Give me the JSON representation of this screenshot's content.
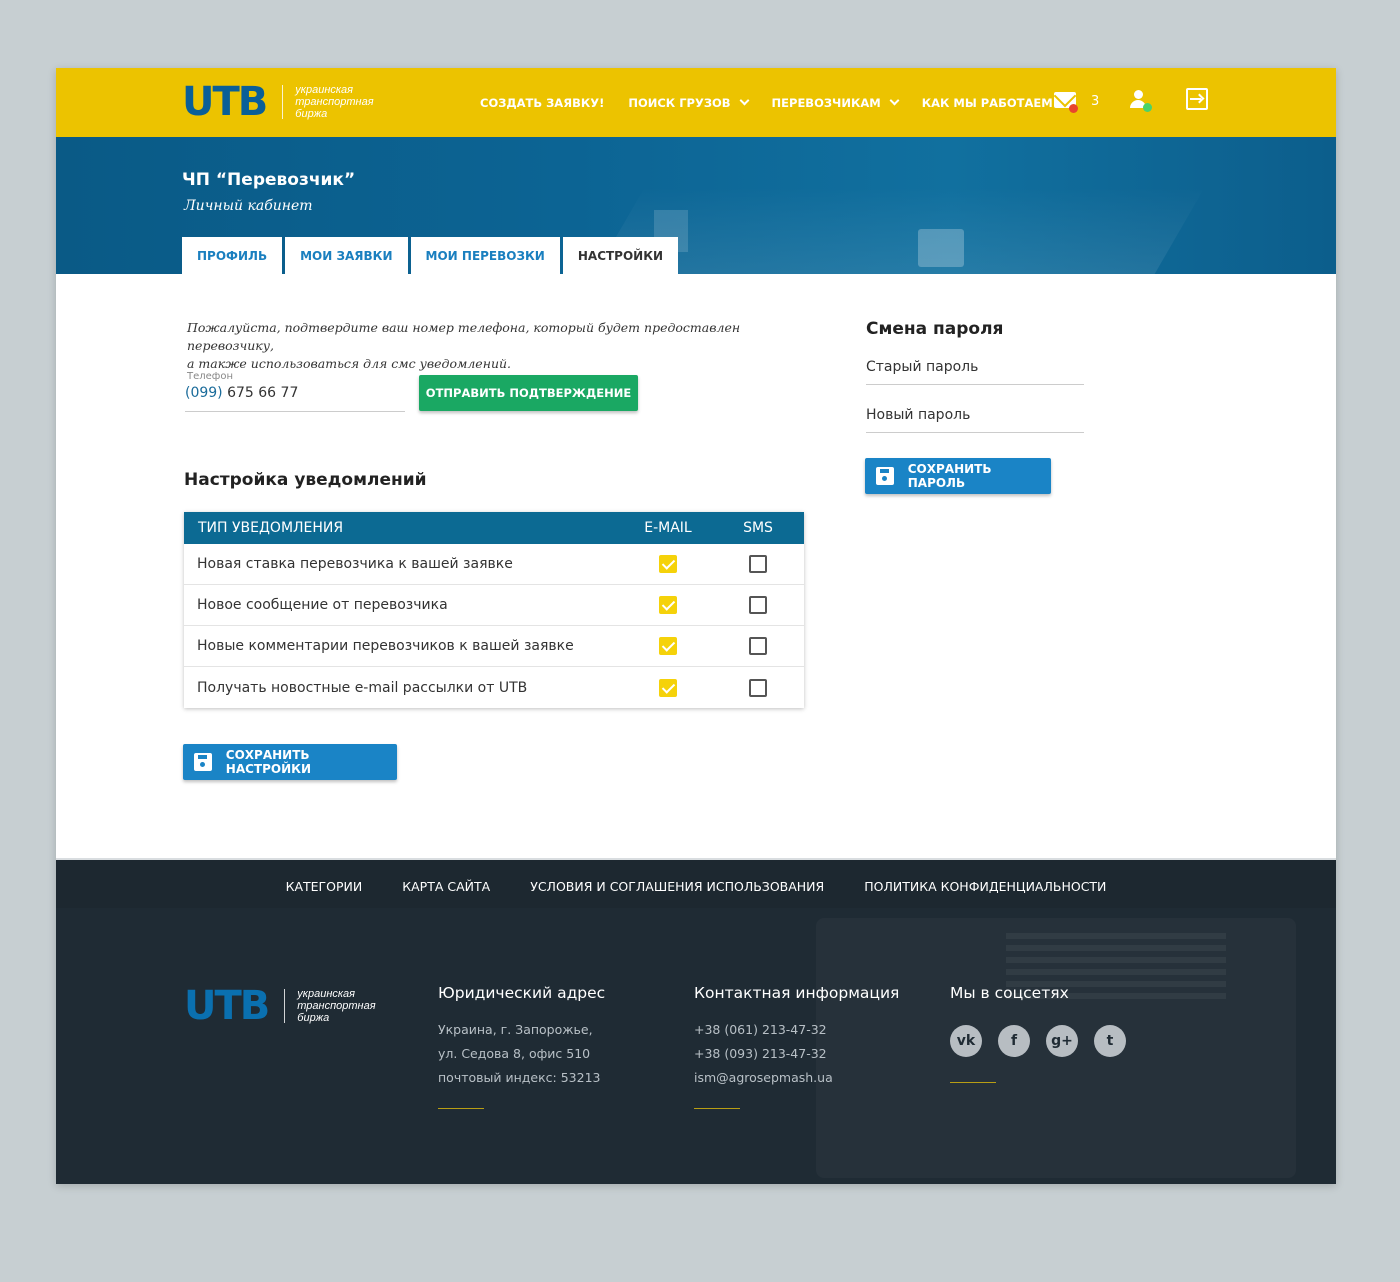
{
  "header": {
    "logo": "UTB",
    "logo_tag": [
      "украинская",
      "транспортная",
      "биржа"
    ],
    "nav": [
      {
        "label": "СОЗДАТЬ ЗАЯВКУ!",
        "dropdown": false
      },
      {
        "label": "ПОИСК ГРУЗОВ",
        "dropdown": true
      },
      {
        "label": "ПЕРЕВОЗЧИКАМ",
        "dropdown": true
      },
      {
        "label": "КАК МЫ РАБОТАЕМ",
        "dropdown": true
      }
    ],
    "mail_count": "3",
    "icons": {
      "mail": "mail-icon",
      "user": "user-icon",
      "logout": "logout-icon"
    },
    "colors": {
      "bar": "#ecc300",
      "mail_dot": "#e8452c",
      "user_dot": "#4ad36a"
    }
  },
  "hero": {
    "company": "ЧП “Перевозчик”",
    "subtitle": "Личный кабинет",
    "tabs": [
      {
        "label": "ПРОФИЛЬ",
        "active": false
      },
      {
        "label": "МОИ ЗАЯВКИ",
        "active": false
      },
      {
        "label": "МОИ ПЕРЕВОЗКИ",
        "active": false
      },
      {
        "label": "НАСТРОЙКИ",
        "active": true
      }
    ]
  },
  "phone": {
    "note_line1": "Пожалуйста, подтвердите ваш номер телефона, который будет предоставлен перевозчику,",
    "note_line2": "а также использоваться для смс уведомлений.",
    "label": "Телефон",
    "code": "(099)",
    "number": " 675 66 77",
    "confirm_button": "ОТПРАВИТЬ ПОДТВЕРЖДЕНИЕ"
  },
  "notifications": {
    "title": "Настройка уведомлений",
    "columns": [
      "ТИП УВЕДОМЛЕНИЯ",
      "E-MAIL",
      "SMS"
    ],
    "rows": [
      {
        "label": "Новая ставка перевозчика к вашей заявке",
        "email": true,
        "sms": false
      },
      {
        "label": "Новое сообщение от перевозчика",
        "email": true,
        "sms": false
      },
      {
        "label": "Новые комментарии перевозчиков к вашей заявке",
        "email": true,
        "sms": false
      },
      {
        "label": "Получать новостные e-mail рассылки от UTB",
        "email": true,
        "sms": false
      }
    ],
    "save_button": "СОХРАНИТЬ НАСТРОЙКИ"
  },
  "password": {
    "title": "Смена пароля",
    "old_label": "Старый пароль",
    "new_label": "Новый пароль",
    "save_button": "СОХРАНИТЬ ПАРОЛЬ"
  },
  "footer": {
    "nav": [
      "КАТЕГОРИИ",
      "КАРТА САЙТА",
      "УСЛОВИЯ И СОГЛАШЕНИЯ ИСПОЛЬЗОВАНИЯ",
      "ПОЛИТИКА КОНФИДЕНЦИАЛЬНОСТИ"
    ],
    "logo": "UTB",
    "logo_tag": [
      "украинская",
      "транспортная",
      "биржа"
    ],
    "address_title": "Юридический  адрес",
    "address": [
      "Украина, г. Запорожье,",
      "ул. Седова 8, офис 510",
      "почтовый индекс: 53213"
    ],
    "contact_title": "Контактная информация",
    "contacts": [
      "+38 (061) 213-47-32",
      "+38 (093) 213-47-32",
      "ism@agrosepmash.ua"
    ],
    "social_title": "Мы в соцсетях",
    "socials": [
      {
        "icon": "vk-icon",
        "glyph": "vk"
      },
      {
        "icon": "facebook-icon",
        "glyph": "f"
      },
      {
        "icon": "google-plus-icon",
        "glyph": "g+"
      },
      {
        "icon": "twitter-icon",
        "glyph": "t"
      }
    ]
  }
}
